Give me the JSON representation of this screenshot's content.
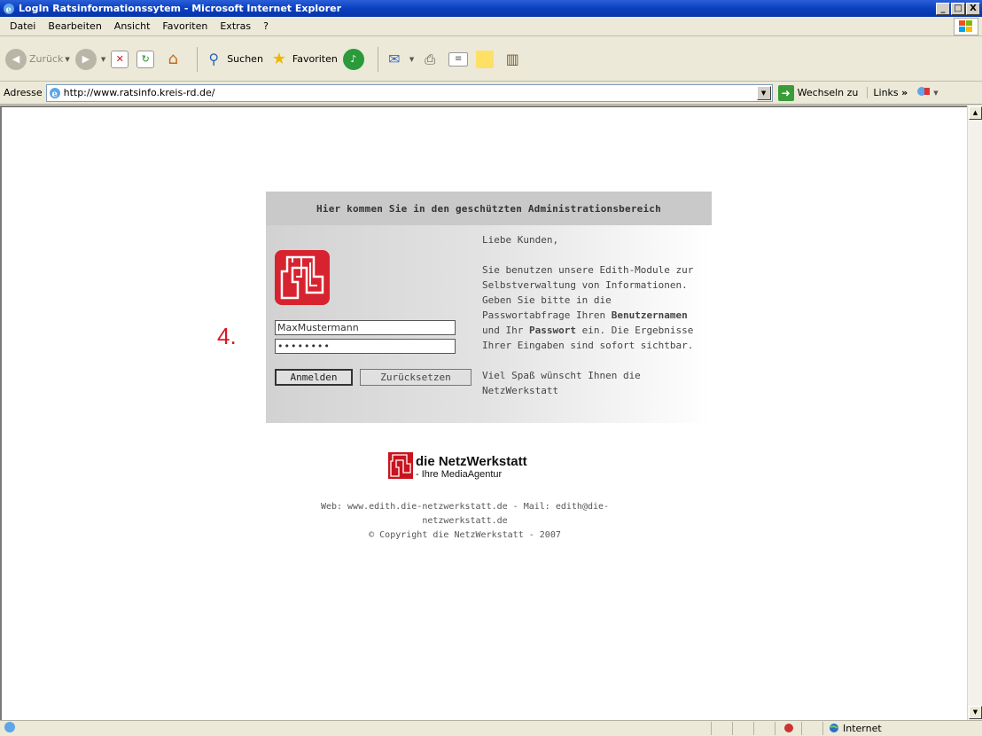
{
  "window": {
    "title": "LogIn Ratsinformationssytem - Microsoft Internet Explorer",
    "min": "_",
    "max": "□",
    "close": "X"
  },
  "menu": [
    "Datei",
    "Bearbeiten",
    "Ansicht",
    "Favoriten",
    "Extras",
    "?"
  ],
  "toolbar": {
    "back": "Zurück",
    "search": "Suchen",
    "favorites": "Favoriten"
  },
  "address": {
    "label": "Adresse",
    "url": "http://www.ratsinfo.kreis-rd.de/",
    "go": "Wechseln zu",
    "links": "Links"
  },
  "login": {
    "heading": "Hier kommen Sie in den geschützten Administrationsbereich",
    "username_value": "MaxMustermann",
    "password_value": "••••••••",
    "login_button": "Anmelden",
    "reset_button": "Zurücksetzen",
    "greeting": "Liebe Kunden,",
    "text_part1": "Sie benutzen unsere Edith-Module zur Selbstverwaltung von Informationen. Geben Sie bitte in die Passwortabfrage Ihren ",
    "text_bold1": "Benutzernamen",
    "text_part2": " und Ihr ",
    "text_bold2": "Passwort",
    "text_part3": " ein. Die Ergebnisse Ihrer Eingaben sind sofort sichtbar.",
    "closing": "Viel Spaß wünscht Ihnen die NetzWerkstatt"
  },
  "step_marker": "4.",
  "footer": {
    "brand": "die NetzWerkstatt",
    "tagline": "- Ihre MediaAgentur",
    "line1": "Web: www.edith.die-netzwerkstatt.de - Mail: edith@die-netzwerkstatt.de",
    "line2": "© Copyright die NetzWerkstatt - 2007"
  },
  "status": {
    "zone": "Internet"
  },
  "colors": {
    "accent_red": "#d7232f",
    "title_blue": "#0a3fbf",
    "go_green": "#3a9b3a"
  }
}
